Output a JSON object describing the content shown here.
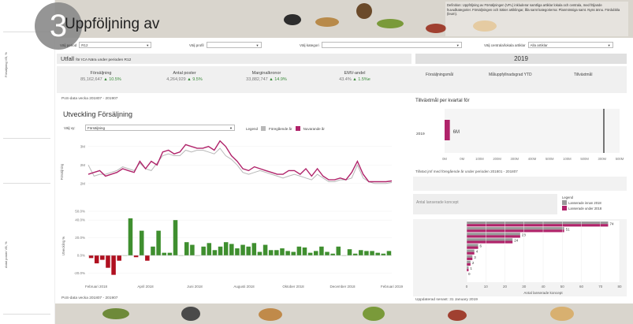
{
  "step_number": "3",
  "title": "Uppföljning av",
  "definition": "Definition: Uppföljning av Försäljningen (VFL) inkluderar samtliga artiklar lokala och centrala, med följande huvudkategorier. Försäljningen och Säker artiklingar, lilla samt kategorierna: Planmössiga samt. Nyss ännu. Fördubbla (leum).",
  "left_labels": [
    "Försäljning VB, %",
    "Antal poster VB, %"
  ],
  "filters": [
    {
      "label": "Välj period",
      "value": "R12"
    },
    {
      "label": "Välj profil",
      "value": ""
    },
    {
      "label": "Välj kategori",
      "value": ""
    },
    {
      "label": "Välj centrala/lokala artiklar",
      "value": "Alla artiklar"
    }
  ],
  "outcome": {
    "title": "Utfall",
    "subtitle": "för ICA Nära under perioden R12"
  },
  "kpis": [
    {
      "label": "Försäljning",
      "value": "85,162,647",
      "change": "▲ 10.5%"
    },
    {
      "label": "Antal poster",
      "value": "4,264,929",
      "change": "▲ 9.5%"
    },
    {
      "label": "Marginalkronor",
      "value": "33,882,747",
      "change": "▲ 14.9%"
    },
    {
      "label": "EMV-andel",
      "value": "43.4%",
      "change": "▲ 1.5%e"
    }
  ],
  "period_text_1": "PoS-data vecka  201807 - 201907",
  "period_text_2": "PoS-data vecka  201807 - 201907",
  "section_title": "Utveckling Försäljning",
  "choose_label": "Välj vy:",
  "choose_value": "Försäljning",
  "legend": {
    "label": "Legend",
    "items": [
      {
        "name": "Föregående år",
        "color": "#b8b8b8"
      },
      {
        "name": "Nuvarande år",
        "color": "#b0236a"
      }
    ]
  },
  "right": {
    "year": "2019",
    "tabs": [
      "Försäljningsmål",
      "Måluppfyllnadsgrad YTD",
      "Tillväxtmål"
    ],
    "growth_title": "Tillväxtmål per kvartal för",
    "growth_row": "2019",
    "growth_value": "6M",
    "growth_period": "Tillväxt jmf med föregående år under perioden  201801 - 201807",
    "concept_title": "Antal lanserade koncept",
    "concept_legend_title": "Legend",
    "concept_legend": [
      {
        "name": "Lanserade innan 2018",
        "color": "#999999"
      },
      {
        "name": "Lanserade under 2018",
        "color": "#b0236a"
      }
    ],
    "concept_xlabel": "Antal lanserade koncept",
    "updated": "Uppdaterad senast:  31 January 2019"
  },
  "colors": {
    "prev": "#b8b8b8",
    "curr": "#b0236a",
    "pos": "#3f8f2f",
    "neg": "#b01020"
  },
  "chart_data": [
    {
      "type": "line",
      "ylabel": "Försäljning",
      "yticks": [
        "3M",
        "2M",
        "2M"
      ],
      "ylim": [
        1.5,
        3.2
      ],
      "x_tick_labels": [
        "Februari 2018",
        "April 2018",
        "Juni 2018",
        "Augusti 2018",
        "Oktober 2018",
        "December 2018",
        "Februari 2019"
      ],
      "series": [
        {
          "name": "Föregående år",
          "values": [
            2.45,
            2.15,
            2.2,
            2.2,
            2.25,
            2.3,
            2.4,
            2.35,
            2.3,
            2.5,
            2.35,
            2.3,
            2.5,
            2.7,
            2.75,
            2.7,
            2.7,
            2.85,
            2.8,
            2.85,
            2.85,
            2.8,
            2.75,
            2.9,
            2.7,
            2.6,
            2.45,
            2.25,
            2.2,
            2.25,
            2.3,
            2.25,
            2.2,
            2.15,
            2.1,
            2.15,
            2.2,
            2.15,
            2.1,
            2.05,
            2.2,
            2.1,
            2.0,
            2.0,
            2.05,
            2.05,
            2.1,
            2.45,
            2.1,
            2.0,
            1.95,
            1.95,
            1.95,
            1.98
          ]
        },
        {
          "name": "Nuvarande år",
          "values": [
            2.2,
            2.25,
            2.3,
            2.15,
            2.2,
            2.25,
            2.35,
            2.3,
            2.25,
            2.55,
            2.35,
            2.55,
            2.45,
            2.8,
            2.85,
            2.75,
            2.8,
            3.0,
            2.95,
            2.9,
            2.9,
            2.95,
            2.85,
            3.1,
            2.95,
            2.7,
            2.55,
            2.35,
            2.3,
            2.4,
            2.35,
            2.3,
            2.25,
            2.2,
            2.2,
            2.3,
            2.3,
            2.2,
            2.35,
            2.15,
            2.35,
            2.15,
            2.05,
            2.05,
            2.1,
            2.05,
            2.25,
            2.55,
            2.2,
            2.0,
            2.0,
            2.0,
            2.0,
            2.02
          ]
        }
      ]
    },
    {
      "type": "bar",
      "ylabel": "Utveckling %",
      "yticks": [
        "50.0%",
        "40.0%",
        "20.0%",
        "0.0%",
        "-20.0%"
      ],
      "ylim": [
        -25,
        50
      ],
      "values": [
        -3,
        -9,
        -5,
        -14,
        -22,
        -6,
        0,
        42,
        -2,
        28,
        -6,
        10,
        28,
        3,
        3,
        40,
        0,
        15,
        12,
        0,
        10,
        14,
        6,
        10,
        15,
        13,
        8,
        12,
        10,
        14,
        4,
        12,
        6,
        6,
        8,
        5,
        4,
        10,
        9,
        3,
        5,
        10,
        4,
        2,
        10,
        0,
        7,
        2,
        6,
        5,
        5,
        3,
        2,
        5
      ]
    },
    {
      "type": "bar",
      "title": "Tillväxtmål per kvartal för",
      "categories": [
        "2019"
      ],
      "values": [
        0.6
      ],
      "xlim": [
        0,
        5
      ],
      "x_tick_labels": [
        "0M",
        "0M",
        "100M",
        "200M",
        "300M",
        "400M",
        "500M",
        "100M",
        "500M",
        "300M",
        "500M"
      ]
    },
    {
      "type": "bar",
      "title": "Antal lanserade koncept",
      "xlabel": "Antal lanserade koncept",
      "xlim": [
        0,
        80
      ],
      "x_tick_labels": [
        "0",
        "10",
        "20",
        "30",
        "40",
        "50",
        "60",
        "70",
        "80"
      ],
      "series": [
        {
          "name": "Lanserade innan 2018",
          "values": [
            74,
            51,
            28,
            24,
            6,
            4,
            3,
            2,
            1,
            0,
            0
          ]
        },
        {
          "name": "Lanserade under 2018",
          "values": [
            74,
            51,
            28,
            24,
            6,
            4,
            3,
            2,
            1,
            0,
            0
          ]
        }
      ],
      "data_labels": [
        "74",
        "51",
        "28",
        "24",
        "6",
        "4",
        "3",
        "2",
        "1",
        "0",
        ""
      ]
    }
  ]
}
